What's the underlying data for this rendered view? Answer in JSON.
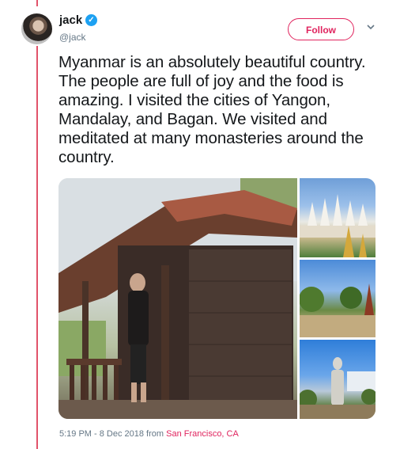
{
  "header": {
    "name": "jack",
    "handle": "@jack",
    "follow_label": "Follow"
  },
  "tweet": {
    "text": "Myanmar is an absolutely beautiful country. The people are full of joy and the food is amazing. I visited the cities of Yangon, Mandalay, and Bagan. We visited and meditated at many monasteries around the country."
  },
  "meta": {
    "timestamp": "5:19 PM - 8 Dec 2018 from ",
    "location": "San Francisco, CA"
  },
  "colors": {
    "accent": "#e0245e",
    "verified": "#1da1f2",
    "muted": "#657786"
  },
  "icons": {
    "verified": "verified-badge-icon",
    "more": "chevron-down-icon"
  }
}
